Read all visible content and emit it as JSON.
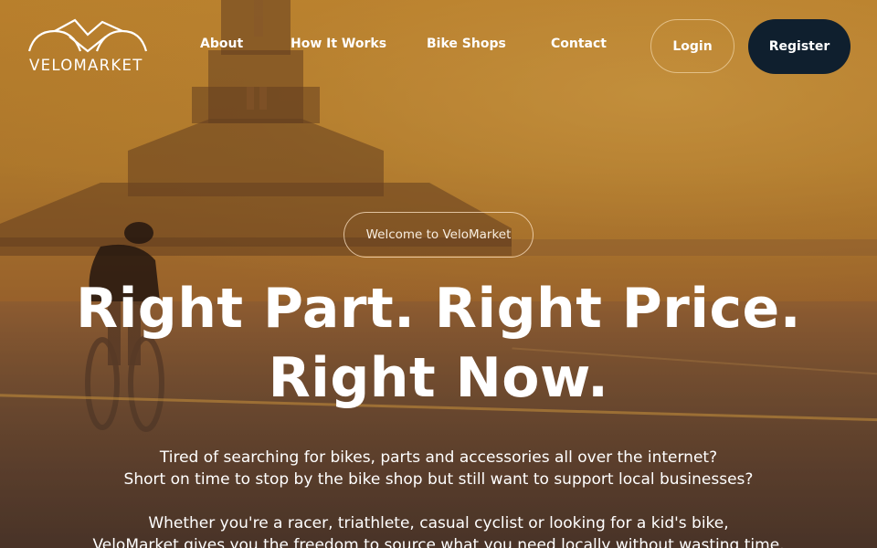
{
  "brand": {
    "name": "VELOMARKET"
  },
  "nav": {
    "links": [
      "About",
      "How It Works",
      "Bike Shops",
      "Contact"
    ],
    "login_label": "Login",
    "register_label": "Register"
  },
  "hero": {
    "welcome": "Welcome to VeloMarket",
    "headline_line1": "Right Part. Right Price.",
    "headline_line2": "Right Now.",
    "para1_line1": "Tired of searching for bikes, parts and accessories all over the internet?",
    "para1_line2": "Short on time to stop by the bike shop but still want to support local businesses?",
    "para2_line1": "Whether you're a racer, triathlete, casual cyclist or looking for a kid's bike,",
    "para2_line2": "VeloMarket gives you the freedom to source what you need locally without wasting time."
  },
  "colors": {
    "register_bg": "#0f1f2e",
    "text": "#ffffff",
    "hero_tone": "#c88a36"
  }
}
